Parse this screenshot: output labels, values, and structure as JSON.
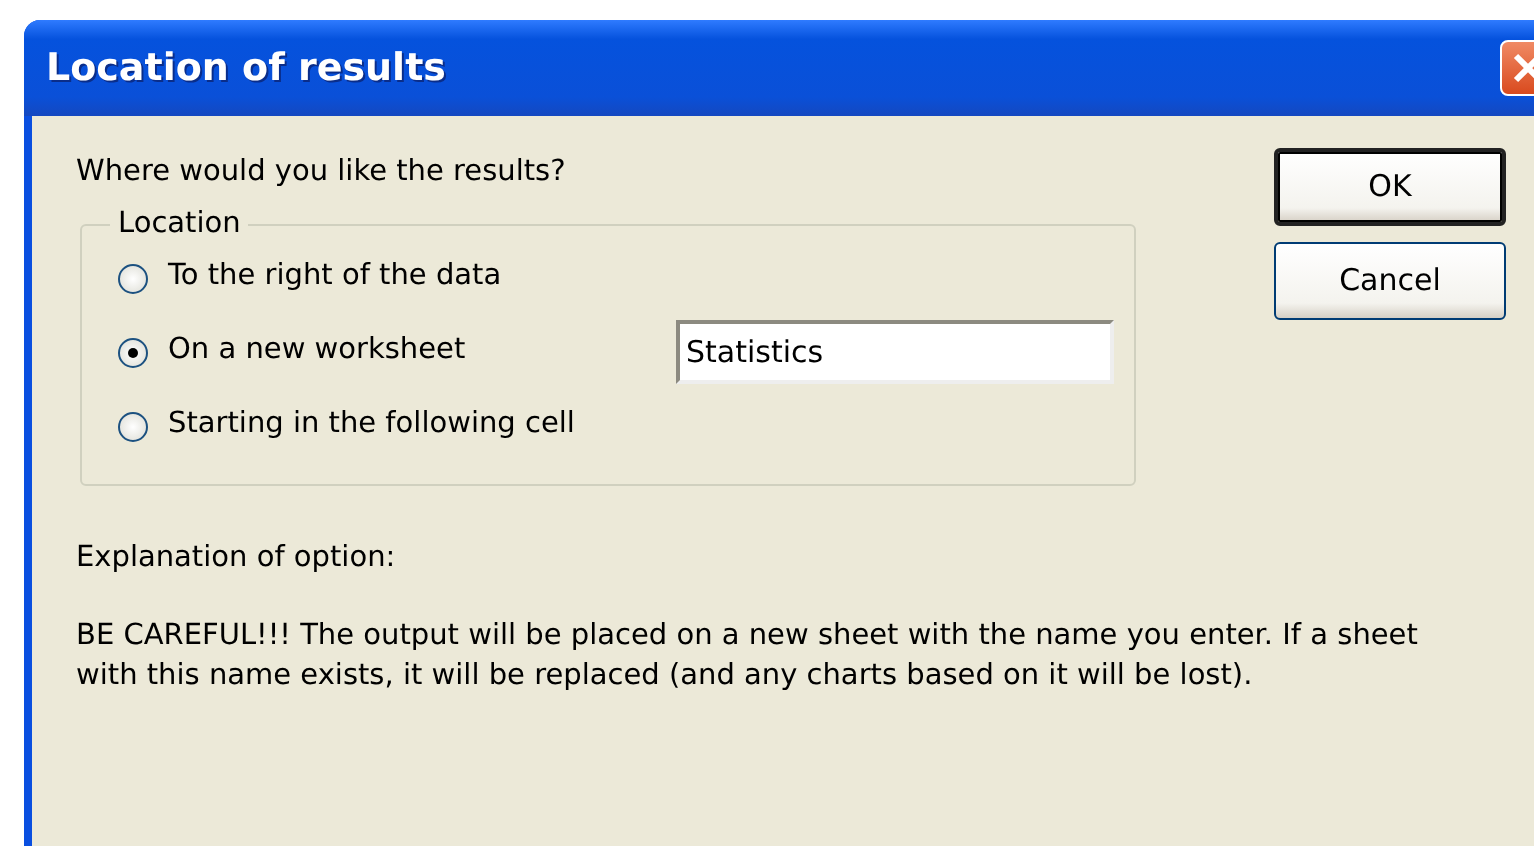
{
  "window": {
    "title": "Location of results"
  },
  "prompt": "Where would you like the results?",
  "group": {
    "label": "Location",
    "options": [
      {
        "label": "To the right of the data",
        "selected": false
      },
      {
        "label": "On a new worksheet",
        "selected": true
      },
      {
        "label": "Starting in the following cell",
        "selected": false
      }
    ],
    "sheet_name_field": {
      "value": "Statistics"
    }
  },
  "buttons": [
    {
      "label": "OK",
      "default": true
    },
    {
      "label": "Cancel",
      "default": false
    }
  ],
  "explanation": {
    "heading": "Explanation of option:",
    "text": "BE CAREFUL!!! The output will be placed on a new sheet with the name you enter. If a sheet with this name exists, it will be replaced (and any charts based on it will be lost)."
  }
}
